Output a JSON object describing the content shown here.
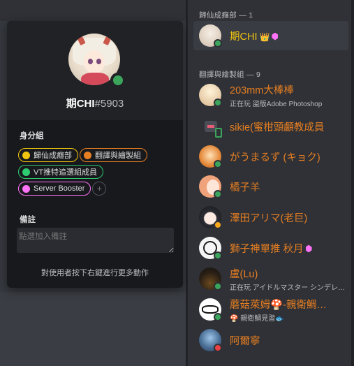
{
  "profile": {
    "username": "期CHI",
    "discriminator": "#5903",
    "roles_title": "身分組",
    "roles": [
      {
        "label": "歸仙成癮部",
        "color": "#f1c40f"
      },
      {
        "label": "翻譯與繪製組",
        "color": "#e67e22"
      },
      {
        "label": "VT推特追選組成員",
        "color": "#2ecc71"
      },
      {
        "label": "Server Booster",
        "color": "#ff73fa"
      }
    ],
    "add_role": "+",
    "note_title": "備註",
    "note_placeholder": "點選加入備註",
    "hint": "對使用者按下右鍵進行更多動作"
  },
  "member_list": {
    "groups": [
      {
        "header": "歸仙成癮部 — 1",
        "members": [
          {
            "name": "期CHI",
            "activity": "",
            "status": "online",
            "crown": "👑",
            "booster": true
          }
        ]
      },
      {
        "header": "翻譯與繪製組 — 9",
        "members": [
          {
            "name": "203mm大棒棒",
            "activity": "正在玩 盜版Adobe Photoshop",
            "status": "online"
          },
          {
            "name": "sikie(蜜柑頭顱教成員",
            "activity": "",
            "status": "mobile"
          },
          {
            "name": "がうまるず (キョク)",
            "activity": "",
            "status": "online"
          },
          {
            "name": "橘子羊",
            "activity": "",
            "status": "online"
          },
          {
            "name": "澤田アリマ(老巨)",
            "activity": "",
            "status": "idle"
          },
          {
            "name": "獅子神單推 秋月",
            "activity": "",
            "status": "online",
            "booster": true
          },
          {
            "name": "盧(Lu)",
            "activity": "正在玩 アイドルマスター シンデレラガールズ",
            "status": "online"
          },
          {
            "name": "蘑菇萊姆🍄-親衛鯛…",
            "activity": "🍄 親衛鯛見習🐟",
            "status": "online"
          },
          {
            "name": "阿爾寧",
            "activity": "",
            "status": "dnd"
          }
        ]
      }
    ]
  },
  "colors": {
    "role_gold": "#f1c40f",
    "role_orange": "#e67e22",
    "online": "#3ba55c",
    "idle": "#faa81a",
    "dnd": "#ed4245"
  }
}
